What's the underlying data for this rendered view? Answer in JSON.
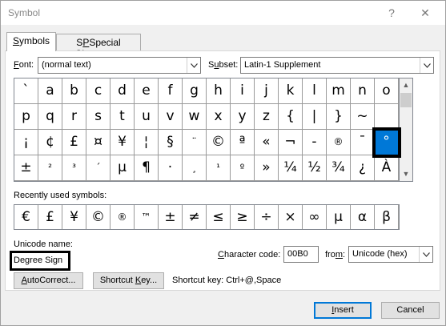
{
  "window": {
    "title": "Symbol",
    "help_glyph": "?",
    "close_glyph": "✕"
  },
  "tabs": [
    {
      "label_pre": "",
      "label_key": "S",
      "label_post": "ymbols"
    },
    {
      "label_pre": "",
      "label_key": "P",
      "label_post": "Special Characters"
    }
  ],
  "font": {
    "label_key": "F",
    "label_post": "ont:",
    "value": "(normal text)"
  },
  "subset": {
    "label_key": "u",
    "label_pre": "S",
    "label_post": "bset:",
    "value": "Latin-1 Supplement"
  },
  "grid": {
    "rows": [
      [
        "`",
        "a",
        "b",
        "c",
        "d",
        "e",
        "f",
        "g",
        "h",
        "i",
        "j",
        "k",
        "l",
        "m",
        "n",
        "o"
      ],
      [
        "p",
        "q",
        "r",
        "s",
        "t",
        "u",
        "v",
        "w",
        "x",
        "y",
        "z",
        "{",
        "|",
        "}",
        "~",
        ""
      ],
      [
        "¡",
        "¢",
        "£",
        "¤",
        "¥",
        "¦",
        "§",
        "¨",
        "©",
        "ª",
        "«",
        "¬",
        "-",
        "®",
        "¯",
        "°"
      ],
      [
        "±",
        "²",
        "³",
        "´",
        "µ",
        "¶",
        "·",
        "¸",
        "¹",
        "º",
        "»",
        "¼",
        "½",
        "¾",
        "¿",
        "À"
      ]
    ],
    "selected": "°"
  },
  "recent": {
    "label": "Recently used symbols:",
    "symbols": [
      "€",
      "£",
      "¥",
      "©",
      "®",
      "™",
      "±",
      "≠",
      "≤",
      "≥",
      "÷",
      "×",
      "∞",
      "µ",
      "α",
      "β"
    ]
  },
  "unicode_name": {
    "label": "Unicode name:",
    "value": "Degree Sign"
  },
  "character_code": {
    "label_pre": "",
    "label_key": "C",
    "label_post": "haracter code:",
    "value": "00B0"
  },
  "from": {
    "label_pre": "fro",
    "label_key": "m",
    "label_post": ":",
    "value": "Unicode (hex)"
  },
  "buttons": {
    "autocorrect": {
      "pre": "",
      "key": "A",
      "post": "utoCorrect..."
    },
    "shortcut_key": {
      "pre": "Shortcut ",
      "key": "K",
      "post": "ey..."
    },
    "insert": {
      "pre": "",
      "key": "I",
      "post": "nsert"
    },
    "cancel": "Cancel"
  },
  "shortcut_text": "Shortcut key: Ctrl+@,Space"
}
